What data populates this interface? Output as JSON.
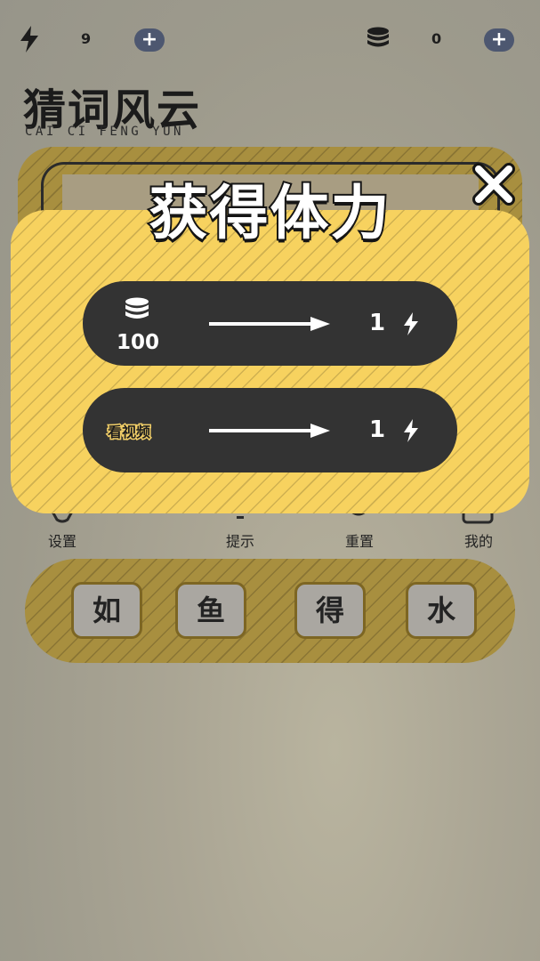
{
  "topbar": {
    "energy_count": "9",
    "coin_count": "0",
    "add_energy_label": "+",
    "add_coins_label": "+"
  },
  "title": {
    "main": "猜词风云",
    "subtitle": "CAI CI FENG YUN"
  },
  "menu": {
    "items": [
      {
        "label": "设置",
        "icon": "gear-icon"
      },
      {
        "label": "提示",
        "icon": "bulb-icon"
      },
      {
        "label": "重置",
        "icon": "reset-icon"
      },
      {
        "label": "我的",
        "icon": "profile-icon"
      }
    ]
  },
  "tiles": [
    "如",
    "鱼",
    "得",
    "水"
  ],
  "modal": {
    "title": "获得体力",
    "close_icon": "close-icon",
    "options": [
      {
        "cost_label": "100",
        "cost_icon": "coins-icon",
        "reward": "1",
        "reward_icon": "bolt-icon"
      },
      {
        "cost_label": "看视频",
        "reward": "1",
        "reward_icon": "bolt-icon"
      }
    ]
  },
  "colors": {
    "accent_yellow": "#f7d25f",
    "row_dark": "#333333",
    "plus_button": "#4d5770"
  }
}
